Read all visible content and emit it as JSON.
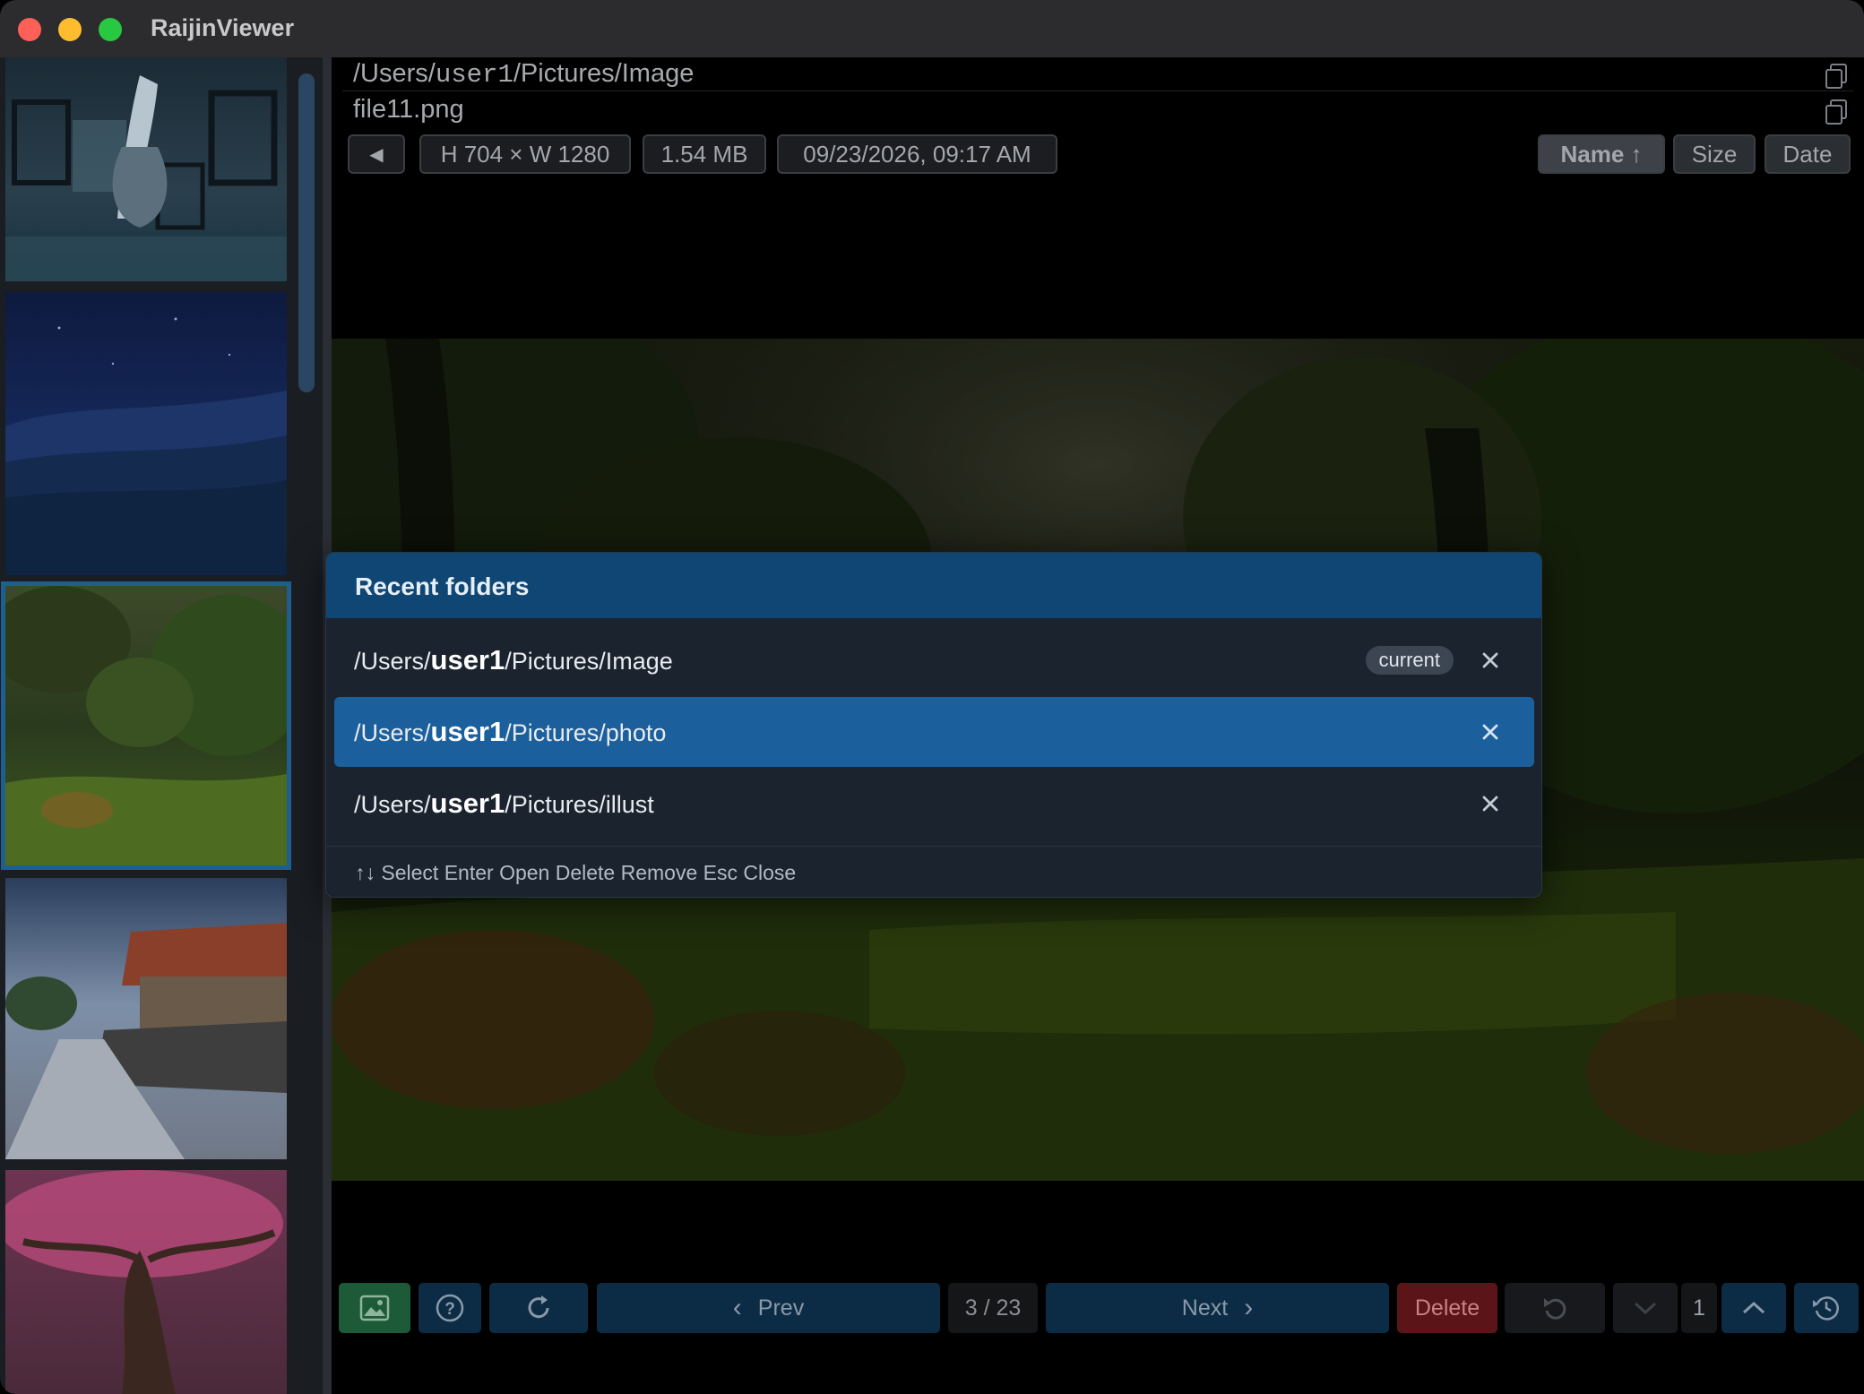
{
  "window": {
    "title": "RaijinViewer"
  },
  "header": {
    "path_prefix": "/Users/",
    "path_user": "user1",
    "path_suffix": "/Pictures/Image",
    "filename": "file11.png",
    "back_glyph": "◀",
    "dimensions": "H 704 × W 1280",
    "filesize": "1.54 MB",
    "date": "09/23/2026, 09:17 AM"
  },
  "sort": {
    "name_label": "Name ↑",
    "size_label": "Size",
    "date_label": "Date",
    "active": "name"
  },
  "sidebar": {
    "thumbnails": [
      {
        "name": "girl-mirrors",
        "selected": false
      },
      {
        "name": "night-field",
        "selected": false
      },
      {
        "name": "forest",
        "selected": true
      },
      {
        "name": "village-road",
        "selected": false
      },
      {
        "name": "pink-tree",
        "selected": false
      }
    ]
  },
  "modal": {
    "title": "Recent folders",
    "items": [
      {
        "prefix": "/Users/",
        "user": "user1",
        "suffix": "/Pictures/Image",
        "badge": "current",
        "selected": false
      },
      {
        "prefix": "/Users/",
        "user": "user1",
        "suffix": "/Pictures/photo",
        "badge": "",
        "selected": true
      },
      {
        "prefix": "/Users/",
        "user": "user1",
        "suffix": "/Pictures/illust",
        "badge": "",
        "selected": false
      }
    ],
    "hint": "↑↓ Select Enter Open Delete Remove Esc Close"
  },
  "toolbar": {
    "prev_label": "Prev",
    "counter": "3 / 23",
    "next_label": "Next",
    "delete_label": "Delete",
    "page_value": "1"
  },
  "icons": {
    "gallery": "image-icon",
    "help": "help-circle-icon",
    "reload": "refresh-icon",
    "undo": "undo-icon",
    "history": "history-icon"
  },
  "colors": {
    "accent_blue": "#1b5f9d",
    "modal_header": "#0f4673",
    "delete_red": "#5b1518",
    "gallery_green": "#1d5a38"
  }
}
